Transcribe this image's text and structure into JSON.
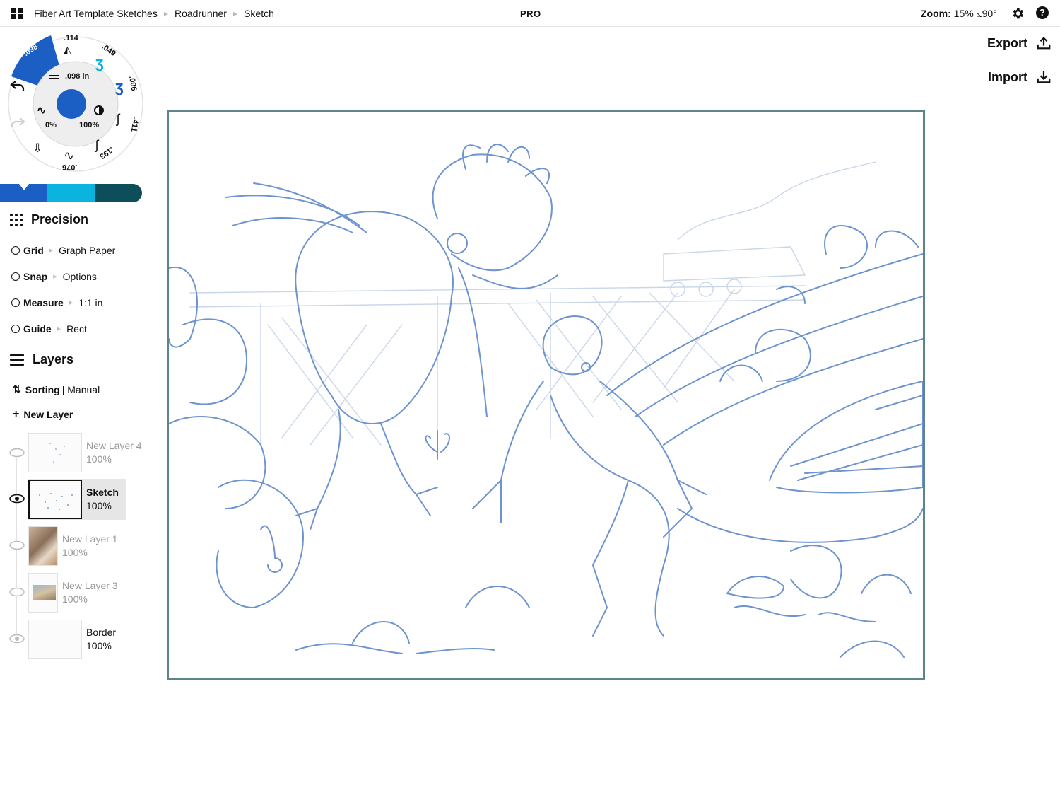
{
  "breadcrumb": {
    "items": [
      "Fiber Art Template Sketches",
      "Roadrunner",
      "Sketch"
    ]
  },
  "header": {
    "badge": "PRO",
    "zoom_label": "Zoom:",
    "zoom_value": "15%",
    "rotation": "⦣90°"
  },
  "actions": {
    "export_label": "Export",
    "import_label": "Import"
  },
  "tool_wheel": {
    "active_size": ".098",
    "size_readout": ".098 in",
    "opacity_min": "0%",
    "opacity_max": "100%",
    "preset_sizes": [
      ".114",
      ".049",
      ".006",
      ".411",
      ".193",
      ".076"
    ],
    "active_color": "#1c5fc4"
  },
  "colors": {
    "swatches": [
      "#1c5fc4",
      "#0bb4de",
      "#0e4e5b"
    ]
  },
  "precision": {
    "title": "Precision",
    "rows": [
      {
        "label": "Grid",
        "value": "Graph Paper"
      },
      {
        "label": "Snap",
        "value": "Options"
      },
      {
        "label": "Measure",
        "value": "1:1 in"
      },
      {
        "label": "Guide",
        "value": "Rect"
      }
    ]
  },
  "layers": {
    "title": "Layers",
    "sorting_label": "Sorting",
    "sorting_value": "| Manual",
    "new_layer_label": "New Layer",
    "items": [
      {
        "name": "New Layer 4",
        "opacity": "100%"
      },
      {
        "name": "Sketch",
        "opacity": "100%"
      },
      {
        "name": "New Layer 1",
        "opacity": "100%"
      },
      {
        "name": "New Layer 3",
        "opacity": "100%"
      },
      {
        "name": "Border",
        "opacity": "100%"
      }
    ]
  },
  "canvas": {
    "frame_color": "#5d8489",
    "stroke_color": "#3b74c6"
  }
}
